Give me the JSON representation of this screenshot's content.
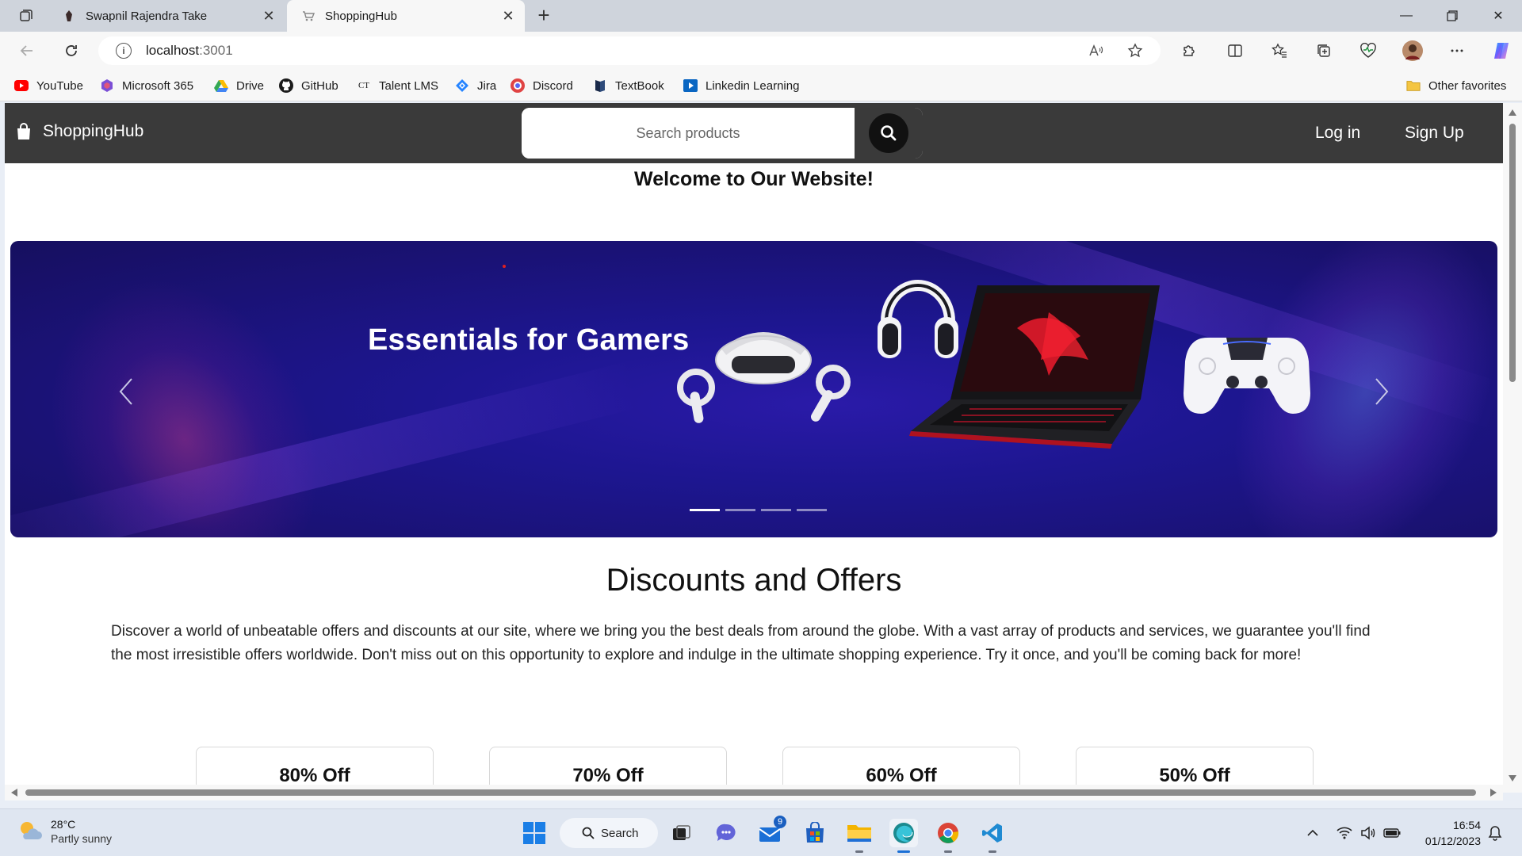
{
  "browser": {
    "tabs": [
      {
        "title": "Swapnil Rajendra Take"
      },
      {
        "title": "ShoppingHub"
      }
    ],
    "address": {
      "host": "localhost",
      "port": ":3001"
    },
    "favorites": [
      {
        "label": "YouTube",
        "icon": "youtube-icon"
      },
      {
        "label": "Microsoft 365",
        "icon": "microsoft365-icon"
      },
      {
        "label": "Drive",
        "icon": "drive-icon"
      },
      {
        "label": "GitHub",
        "icon": "github-icon"
      },
      {
        "label": "Talent LMS",
        "icon": "talentlms-icon"
      },
      {
        "label": "Jira",
        "icon": "jira-icon"
      },
      {
        "label": "Discord",
        "icon": "discord-icon"
      },
      {
        "label": "TextBook",
        "icon": "textbook-icon"
      },
      {
        "label": "Linkedin Learning",
        "icon": "linkedin-learning-icon"
      }
    ],
    "other_favorites": "Other favorites"
  },
  "site": {
    "logo": "ShoppingHub",
    "search_placeholder": "Search products",
    "login": "Log in",
    "signup": "Sign Up",
    "welcome": "Welcome to Our Website!",
    "carousel": {
      "title": "Essentials for Gamers",
      "slides": 4,
      "active_slide": 1
    },
    "offers": {
      "title": "Discounts and Offers",
      "description": "Discover a world of unbeatable offers and discounts at our site, where we bring you the best deals from around the globe. With a vast array of products and services, we guarantee you'll find the most irresistible offers worldwide. Don't miss out on this opportunity to explore and indulge in the ultimate shopping experience. Try it once, and you'll be coming back for more!",
      "cards": [
        "80% Off",
        "70% Off",
        "60% Off",
        "50% Off"
      ]
    }
  },
  "taskbar": {
    "weather_temp": "28°C",
    "weather_desc": "Partly sunny",
    "search_label": "Search",
    "mail_badge": "9",
    "time": "16:54",
    "date": "01/12/2023"
  },
  "colors": {
    "header_bg": "#3a3a3a",
    "carousel_bg": "#1d1690"
  }
}
